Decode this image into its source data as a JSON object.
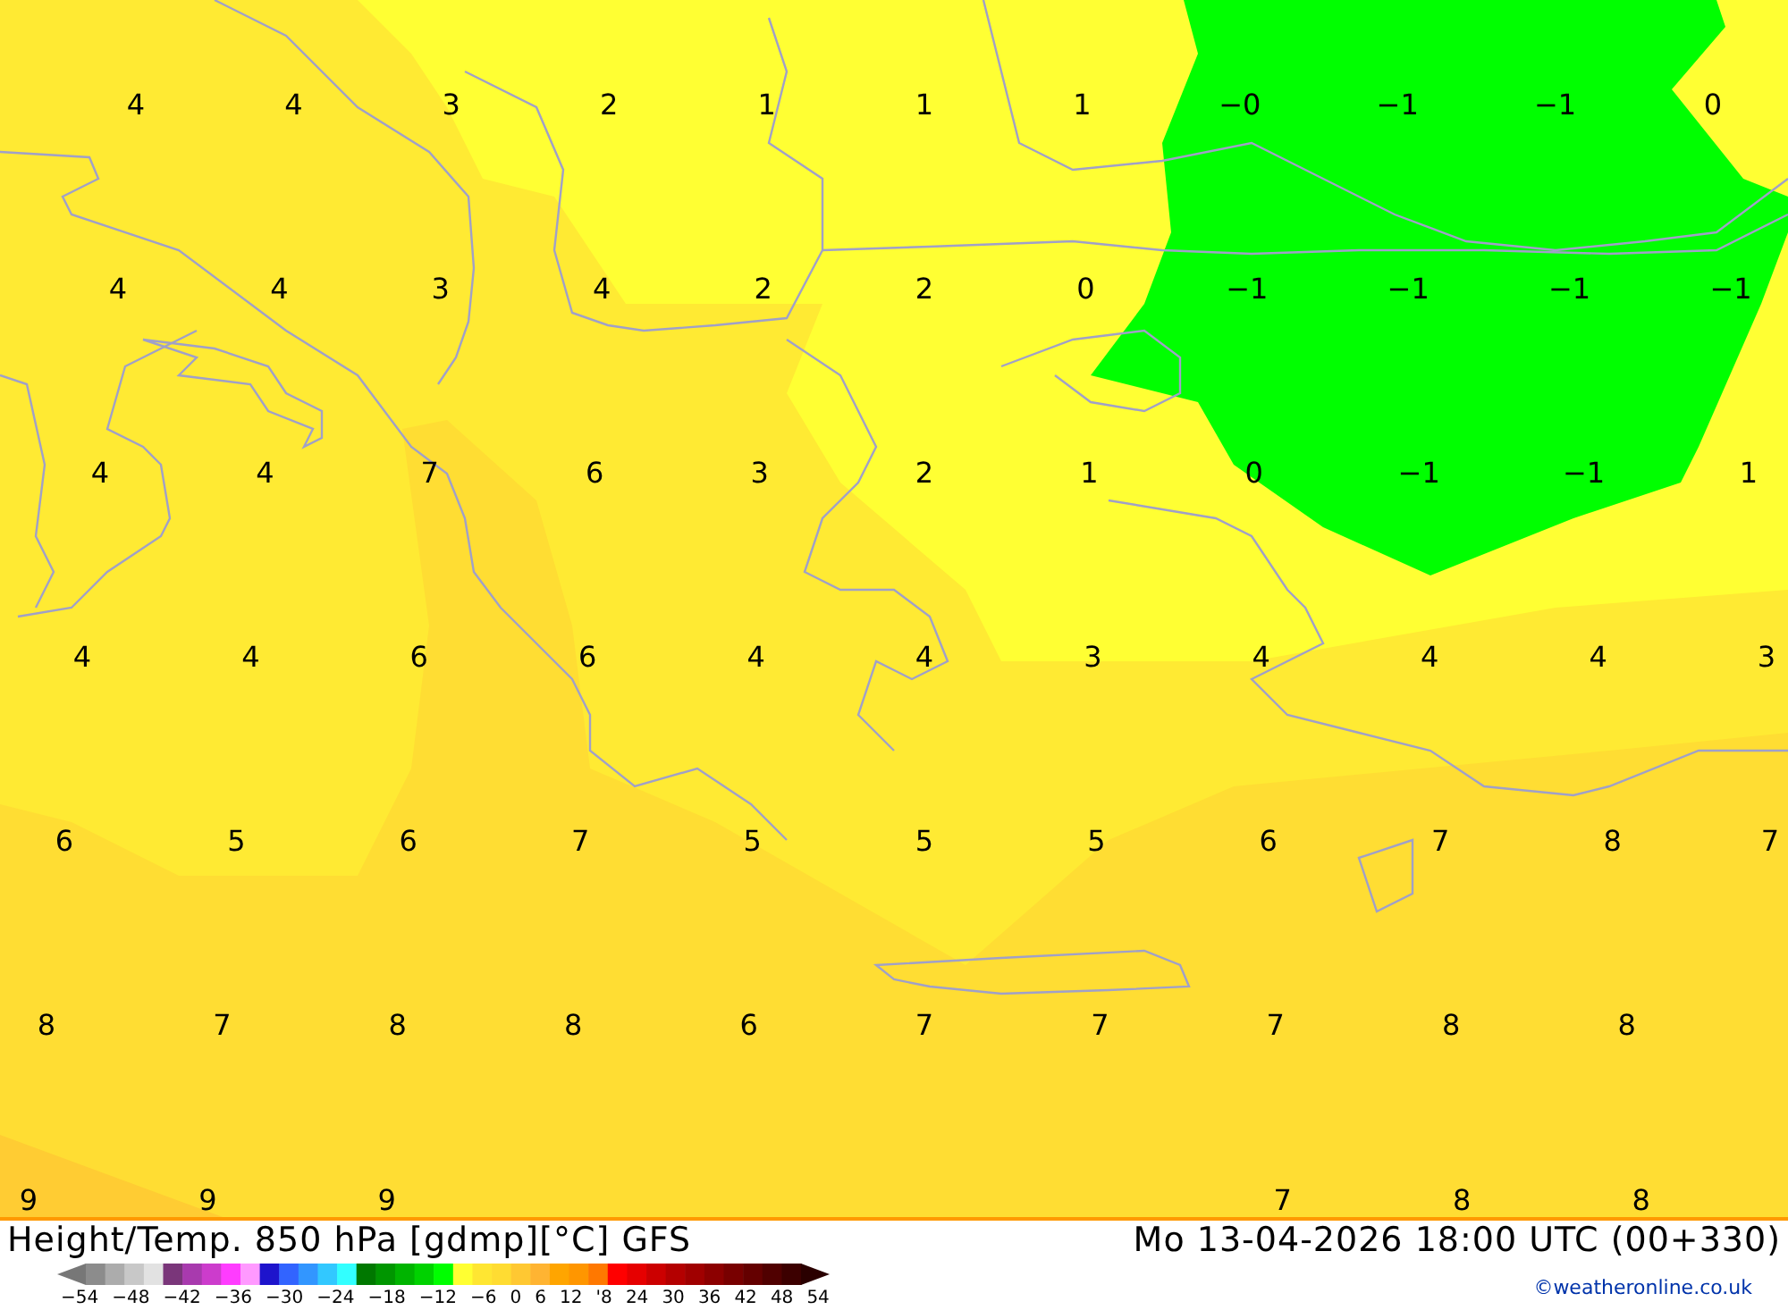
{
  "map": {
    "label_rows": [
      [
        "4",
        "4",
        "3",
        "2",
        "1",
        "1",
        "1",
        "−0",
        "−1",
        "−1",
        "0"
      ],
      [
        "4",
        "4",
        "3",
        "4",
        "2",
        "2",
        "0",
        "−1",
        "−1",
        "−1",
        "−1"
      ],
      [
        "4",
        "4",
        "7",
        "6",
        "3",
        "2",
        "1",
        "0",
        "−1",
        "−1",
        "1"
      ],
      [
        "4",
        "4",
        "6",
        "6",
        "4",
        "4",
        "3",
        "4",
        "4",
        "4",
        "3"
      ],
      [
        "6",
        "5",
        "6",
        "7",
        "5",
        "5",
        "5",
        "6",
        "7",
        "8",
        "7"
      ],
      [
        "8",
        "7",
        "8",
        "8",
        "6",
        "7",
        "7",
        "7",
        "8",
        "8"
      ],
      [
        "9",
        "9",
        "9",
        null,
        null,
        null,
        null,
        "7",
        "8",
        "8"
      ]
    ]
  },
  "title": "Height/Temp. 850 hPa [gdmp][°C] GFS",
  "valid_time": "Mo 13-04-2026 18:00 UTC (00+330)",
  "legend": {
    "swatches": [
      {
        "color": "#8c8c8c"
      },
      {
        "color": "#acacac"
      },
      {
        "color": "#c8c8c8"
      },
      {
        "color": "#e2e2e2"
      },
      {
        "color": "#7a367a"
      },
      {
        "color": "#a83aae"
      },
      {
        "color": "#cc3ccc"
      },
      {
        "color": "#ff3cff"
      },
      {
        "color": "#ff99ff"
      },
      {
        "color": "#1e14cc"
      },
      {
        "color": "#3264ff"
      },
      {
        "color": "#3296ff"
      },
      {
        "color": "#32c8ff"
      },
      {
        "color": "#32ffff"
      },
      {
        "color": "#007800"
      },
      {
        "color": "#009600"
      },
      {
        "color": "#00b400"
      },
      {
        "color": "#00d200"
      },
      {
        "color": "#00ff00"
      },
      {
        "color": "#ffff32"
      },
      {
        "color": "#ffe632"
      },
      {
        "color": "#ffdc32"
      },
      {
        "color": "#ffc832"
      },
      {
        "color": "#ffb432"
      },
      {
        "color": "#ffa500"
      },
      {
        "color": "#ff9600"
      },
      {
        "color": "#ff7800"
      },
      {
        "color": "#ff0000"
      },
      {
        "color": "#e60000"
      },
      {
        "color": "#cc0000"
      },
      {
        "color": "#b40000"
      },
      {
        "color": "#a00000"
      },
      {
        "color": "#8c0000"
      },
      {
        "color": "#780000"
      },
      {
        "color": "#640000"
      },
      {
        "color": "#500000"
      },
      {
        "color": "#3c0000"
      }
    ],
    "ticks": [
      "−54",
      "−48",
      "−42",
      "−36",
      "−30",
      "−24",
      "−18",
      "−12",
      "−6",
      "0",
      "6",
      "12",
      "'8",
      "24",
      "30",
      "36",
      "42",
      "48",
      "54"
    ]
  },
  "copyright": "©weatheronline.co.uk"
}
